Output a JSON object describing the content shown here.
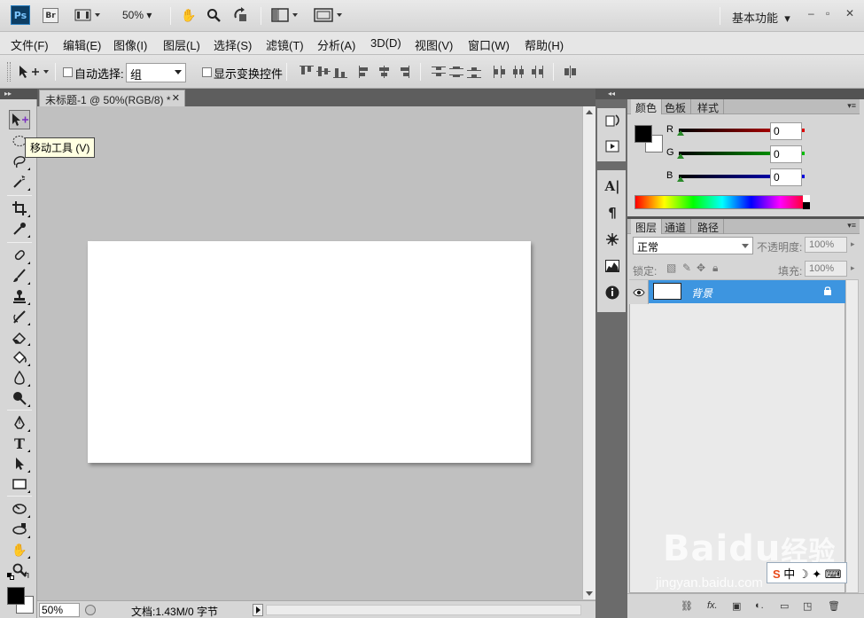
{
  "app": {
    "logo_text": "Ps",
    "bridge_text": "Br",
    "zoom": "50%",
    "workspace": "基本功能"
  },
  "menu": [
    "文件(F)",
    "编辑(E)",
    "图像(I)",
    "图层(L)",
    "选择(S)",
    "滤镜(T)",
    "分析(A)",
    "3D(D)",
    "视图(V)",
    "窗口(W)",
    "帮助(H)"
  ],
  "options": {
    "auto_select_label": "自动选择:",
    "auto_select_value": "组",
    "show_transform_label": "显示变换控件"
  },
  "tooltip": "移动工具 (V)",
  "document": {
    "tab_title": "未标题-1 @ 50%(RGB/8) *",
    "status_zoom": "50%",
    "status_info": "文档:1.43M/0 字节"
  },
  "color_panel": {
    "tabs": [
      "颜色",
      "色板",
      "样式"
    ],
    "channels": [
      {
        "label": "R",
        "value": "0",
        "color": "#e00000"
      },
      {
        "label": "G",
        "value": "0",
        "color": "#00c000"
      },
      {
        "label": "B",
        "value": "0",
        "color": "#0000e0"
      }
    ]
  },
  "layers_panel": {
    "tabs": [
      "图层",
      "通道",
      "路径"
    ],
    "blend_mode": "正常",
    "opacity_label": "不透明度:",
    "opacity_value": "100%",
    "lock_label": "锁定:",
    "fill_label": "填充:",
    "fill_value": "100%",
    "layer_name": "背景"
  },
  "watermark": {
    "brand": "Baidu",
    "brand_cn": "经验",
    "url": "jingyan.baidu.com",
    "ime_text": "中"
  }
}
